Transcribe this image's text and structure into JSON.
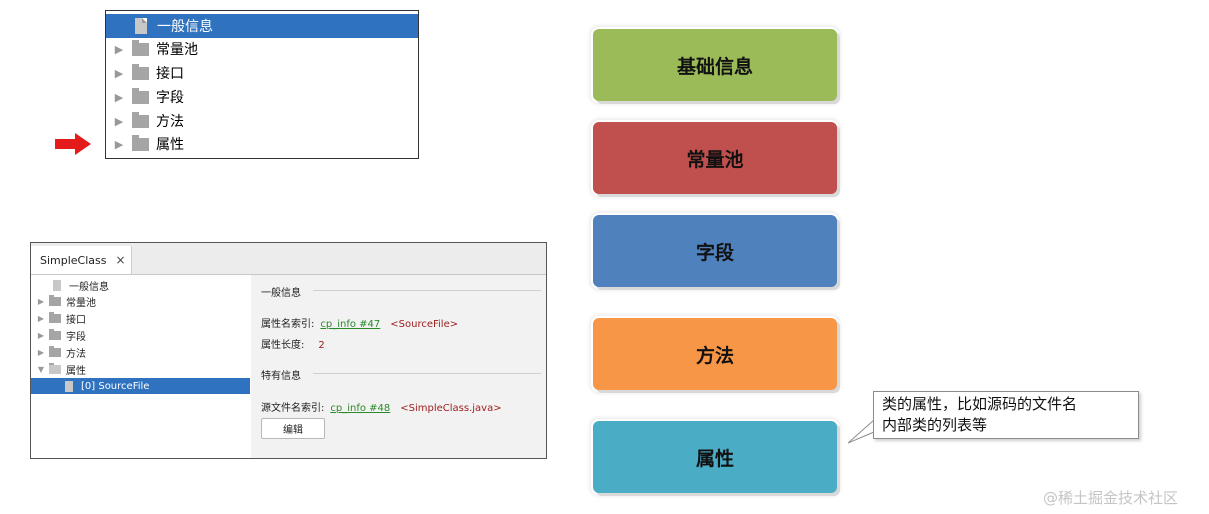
{
  "top_tree": {
    "items": [
      {
        "label": "一般信息",
        "kind": "doc",
        "selected": true
      },
      {
        "label": "常量池",
        "kind": "folder"
      },
      {
        "label": "接口",
        "kind": "folder"
      },
      {
        "label": "字段",
        "kind": "folder"
      },
      {
        "label": "方法",
        "kind": "folder"
      },
      {
        "label": "属性",
        "kind": "folder"
      }
    ]
  },
  "window": {
    "tab_label": "SimpleClass",
    "tab_close": "×",
    "tree": [
      {
        "label": "一般信息",
        "kind": "doc"
      },
      {
        "label": "常量池",
        "kind": "folder"
      },
      {
        "label": "接口",
        "kind": "folder"
      },
      {
        "label": "字段",
        "kind": "folder"
      },
      {
        "label": "方法",
        "kind": "folder"
      },
      {
        "label": "属性",
        "kind": "folder-open"
      },
      {
        "label": "[0] SourceFile",
        "kind": "doc",
        "selected": true
      }
    ],
    "general_section": "一般信息",
    "attr_name_index_label": "属性名索引:",
    "attr_name_index_link": "cp_info #47",
    "attr_name_index_value": "<SourceFile>",
    "attr_length_label": "属性长度:",
    "attr_length_value": "2",
    "specific_section": "特有信息",
    "source_file_index_label": "源文件名索引:",
    "source_file_index_link": "cp_info #48",
    "source_file_index_value": "<SimpleClass.java>",
    "edit_button": "编辑"
  },
  "boxes": [
    {
      "label": "基础信息",
      "color": "#9bbb59"
    },
    {
      "label": "常量池",
      "color": "#c0504d"
    },
    {
      "label": "字段",
      "color": "#4f81bd"
    },
    {
      "label": "方法",
      "color": "#f79646"
    },
    {
      "label": "属性",
      "color": "#4bacc6"
    }
  ],
  "callout": {
    "line1": "类的属性，比如源码的文件名",
    "line2": "内部类的列表等"
  },
  "watermark": "@稀土掘金技术社区",
  "colors": {
    "selection": "#2f72bf",
    "arrow": "#e31b1b",
    "link": "#2a8a2a",
    "value": "#a02020"
  }
}
